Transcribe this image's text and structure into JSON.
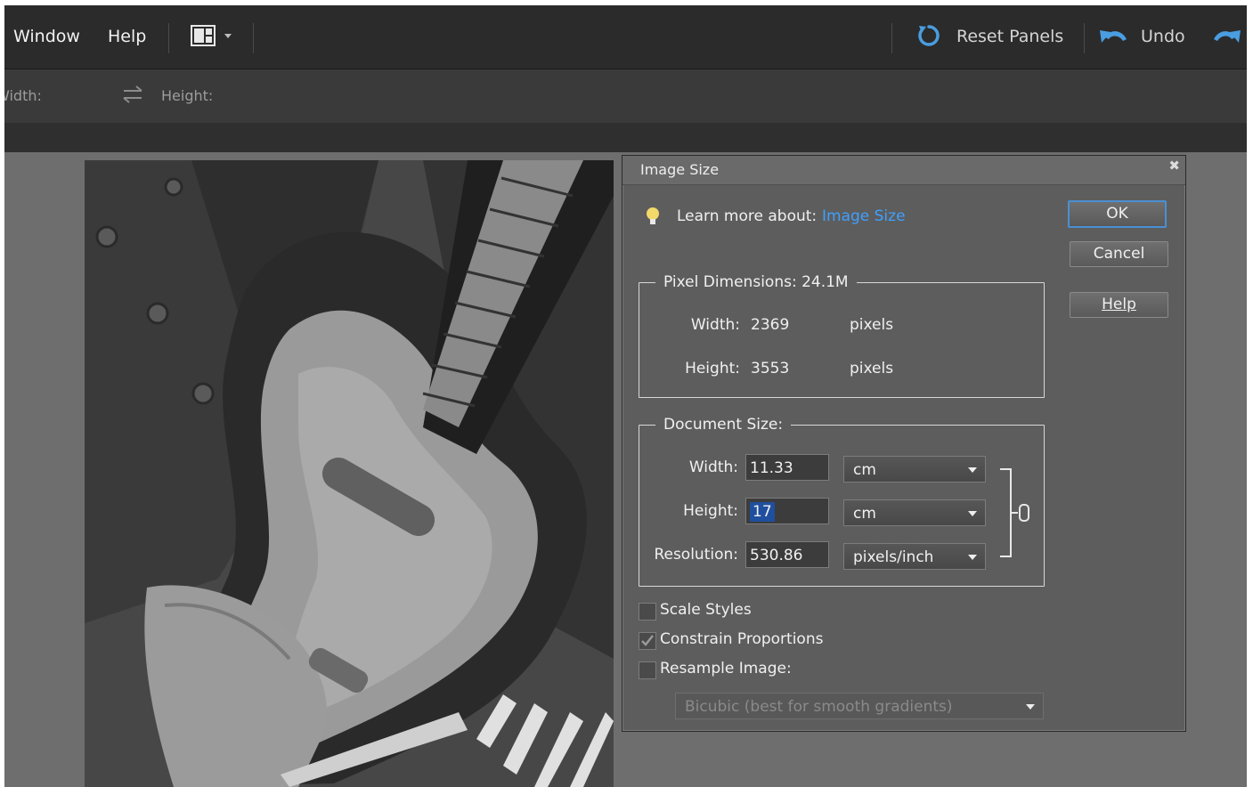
{
  "menubar": {
    "window": "Window",
    "help": "Help",
    "reset_panels": "Reset Panels",
    "undo": "Undo"
  },
  "options": {
    "width_label": "Width:",
    "height_label": "Height:"
  },
  "dialog": {
    "title": "Image Size",
    "learn_prefix": "Learn more about:",
    "learn_link": "Image Size",
    "ok": "OK",
    "cancel": "Cancel",
    "help": "Help",
    "pixel_dimensions": {
      "label": "Pixel Dimensions:",
      "size": "24.1M",
      "width_label": "Width:",
      "width_value": "2369",
      "width_unit": "pixels",
      "height_label": "Height:",
      "height_value": "3553",
      "height_unit": "pixels"
    },
    "document_size": {
      "label": "Document Size:",
      "width_label": "Width:",
      "width_value": "11.33",
      "width_unit": "cm",
      "height_label": "Height:",
      "height_value": "17",
      "height_unit": "cm",
      "resolution_label": "Resolution:",
      "resolution_value": "530.86",
      "resolution_unit": "pixels/inch"
    },
    "scale_styles": "Scale Styles",
    "constrain_proportions": "Constrain Proportions",
    "resample_image": "Resample Image:",
    "resample_method": "Bicubic (best for smooth gradients)",
    "checks": {
      "scale_styles": false,
      "constrain_proportions": true,
      "resample_image": false
    }
  },
  "colors": {
    "accent": "#4a8fd4",
    "link": "#3fa0ff",
    "menubar": "#2b2b2b"
  }
}
